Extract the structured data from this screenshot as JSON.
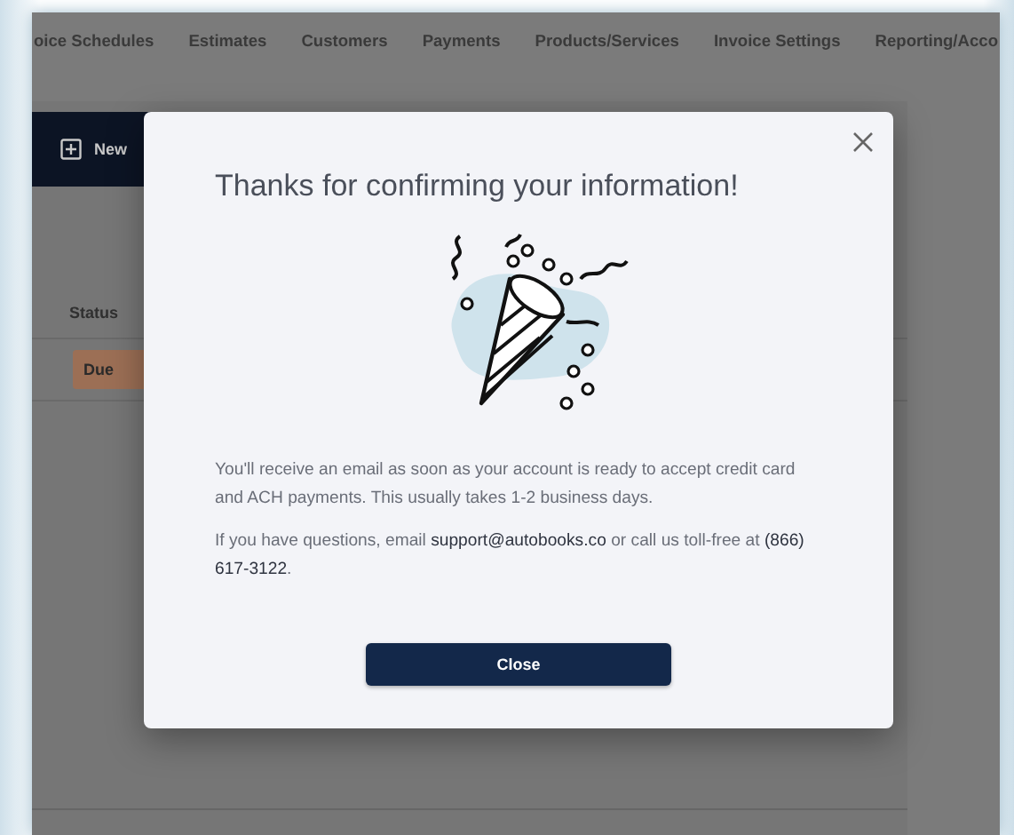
{
  "nav_tabs": [
    {
      "label": "oice Schedules"
    },
    {
      "label": "Estimates"
    },
    {
      "label": "Customers"
    },
    {
      "label": "Payments"
    },
    {
      "label": "Products/Services"
    },
    {
      "label": "Invoice Settings"
    },
    {
      "label": "Reporting/Acco"
    }
  ],
  "new_button": {
    "label": "New"
  },
  "table": {
    "columns": [
      "Status"
    ],
    "rows": [
      {
        "status": "Due"
      }
    ]
  },
  "modal": {
    "title": "Thanks for confirming your information!",
    "paragraph_1": "You'll receive an email as soon as your account is ready to accept credit card and ACH payments. This usually takes 1-2 business days.",
    "paragraph_2": {
      "before": "If you have questions, email ",
      "email": "support@autobooks.co",
      "middle": " or call us toll-free at ",
      "phone": "(866) 617-3122",
      "after": "."
    },
    "close_button": "Close"
  }
}
